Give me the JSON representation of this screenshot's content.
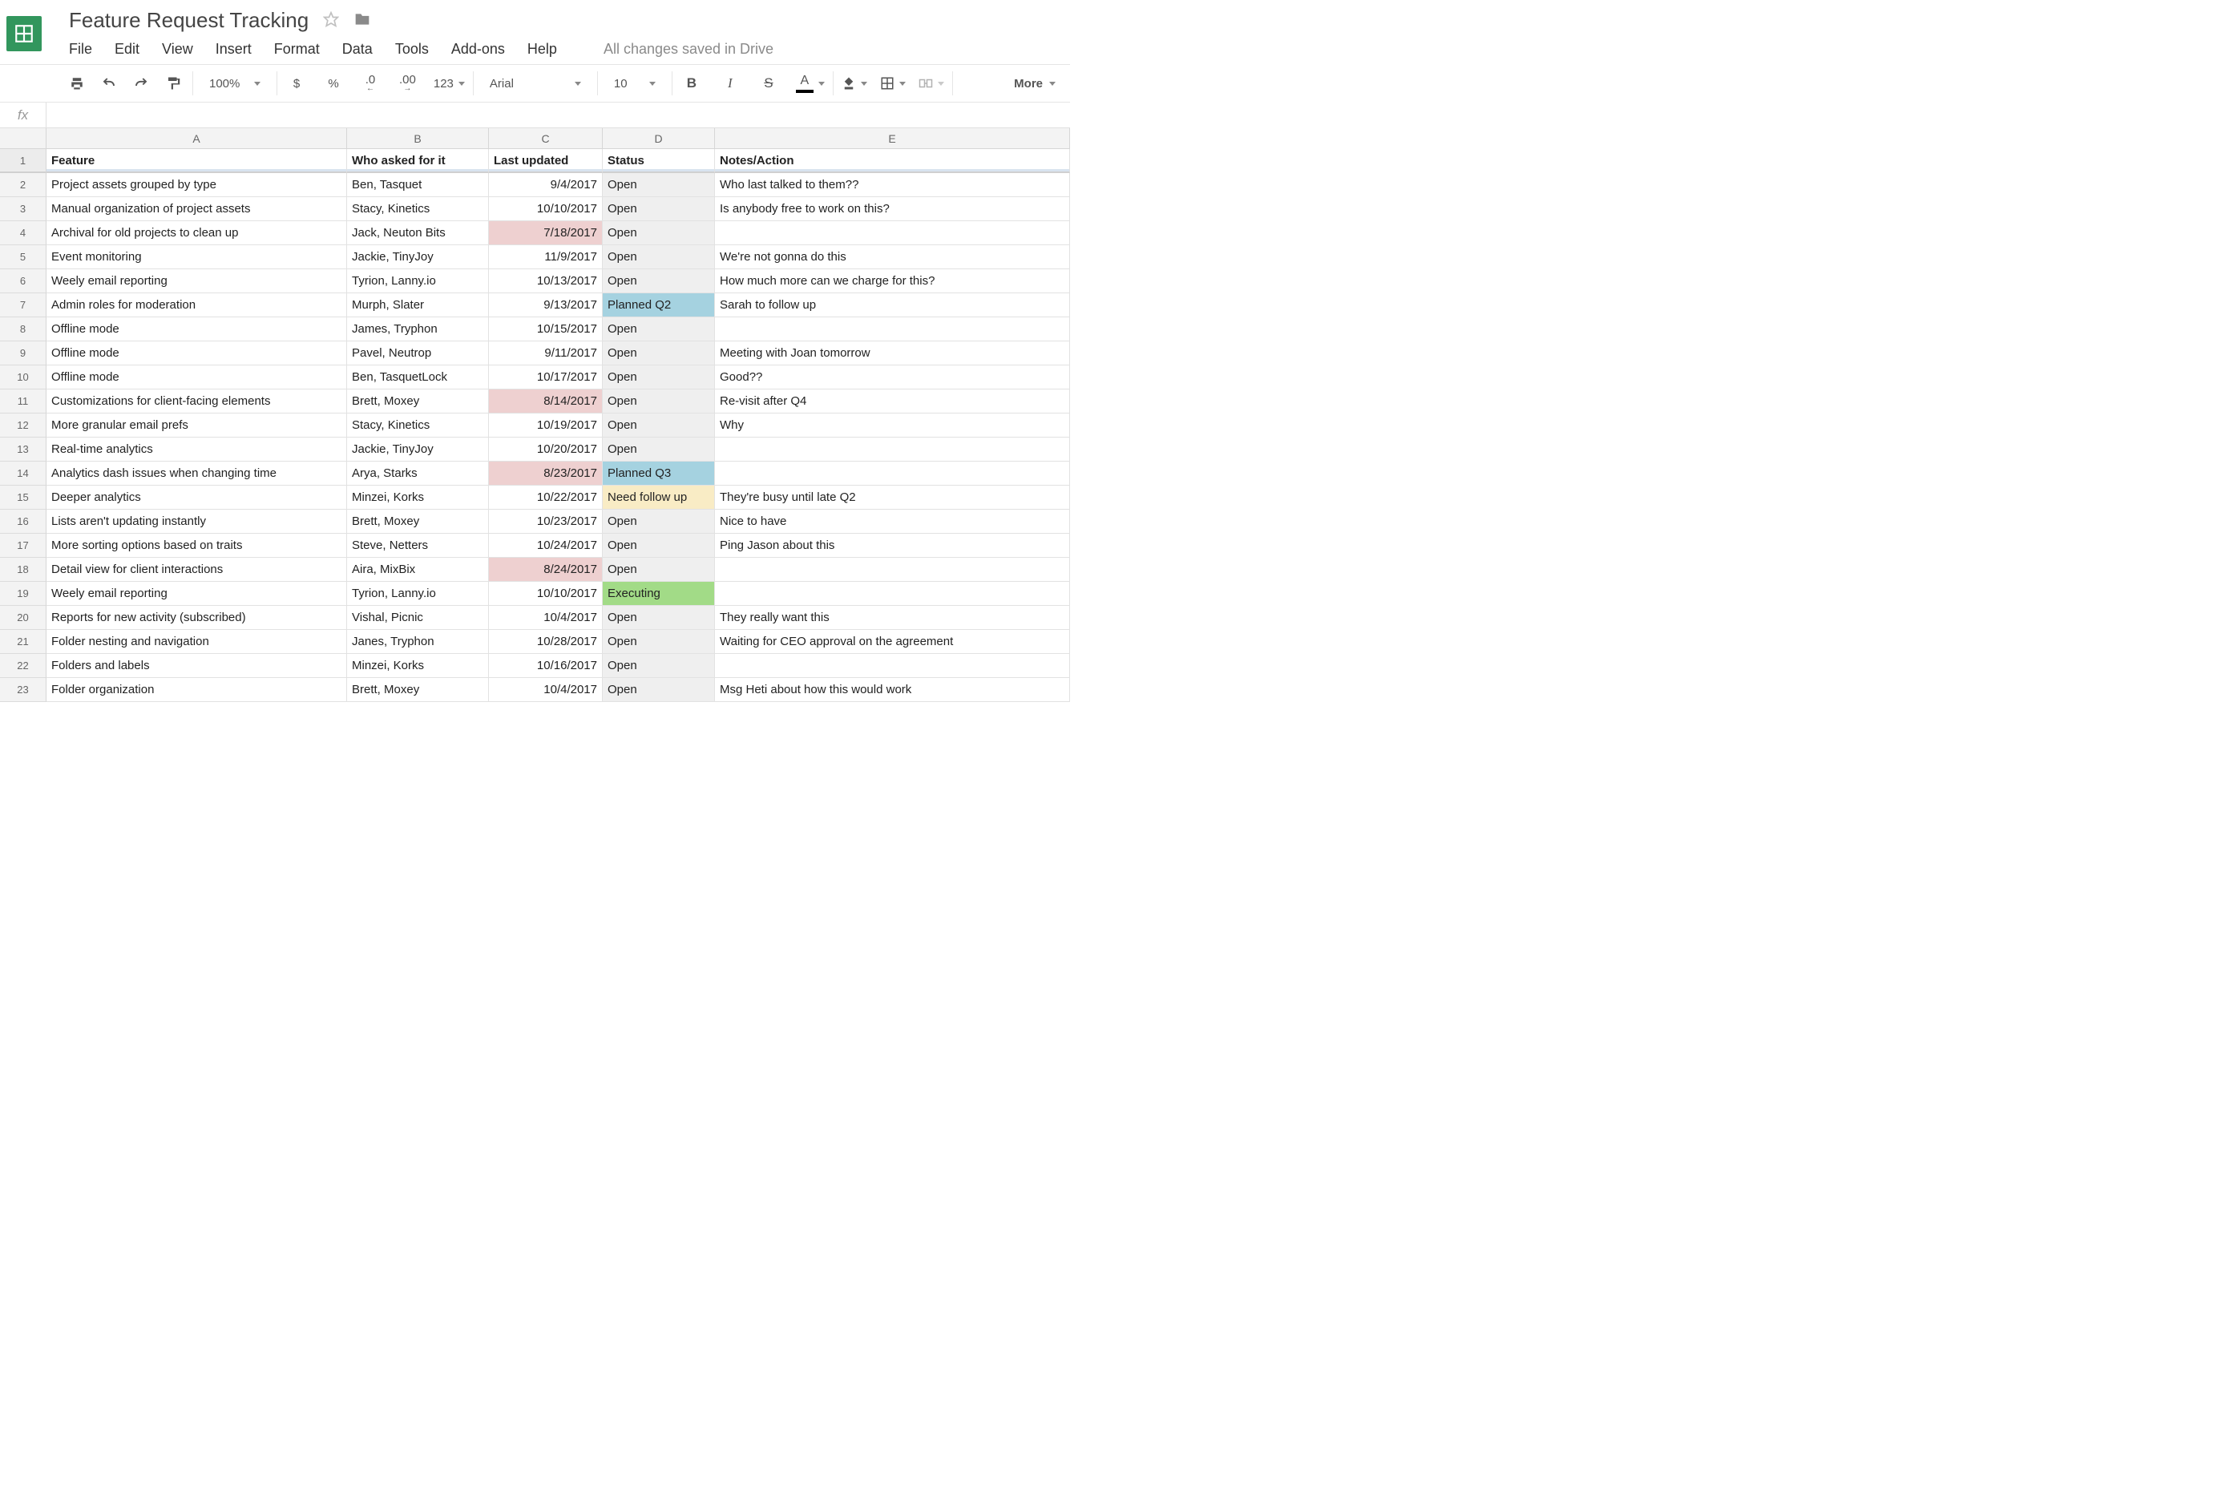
{
  "doc": {
    "title": "Feature Request Tracking"
  },
  "menu": {
    "file": "File",
    "edit": "Edit",
    "view": "View",
    "insert": "Insert",
    "format": "Format",
    "data": "Data",
    "tools": "Tools",
    "addons": "Add-ons",
    "help": "Help",
    "save_status": "All changes saved in Drive"
  },
  "toolbar": {
    "zoom": "100%",
    "font": "Arial",
    "size": "10",
    "dollar": "$",
    "percent": "%",
    "dec_dec": ".0",
    "dec_inc": ".00",
    "num123": "123",
    "bold": "B",
    "italic": "I",
    "strike": "S",
    "textA": "A",
    "more": "More"
  },
  "formula": {
    "fx": "fx",
    "value": ""
  },
  "columns": [
    "A",
    "B",
    "C",
    "D",
    "E"
  ],
  "headers": {
    "feature": "Feature",
    "who": "Who asked for it",
    "updated": "Last updated",
    "status": "Status",
    "notes": "Notes/Action"
  },
  "rows": [
    {
      "n": "2",
      "a": "Project assets grouped by type",
      "b": "Ben, Tasquet",
      "c": "9/4/2017",
      "d": "Open",
      "dClass": "status-open",
      "e": "Who last talked to them??"
    },
    {
      "n": "3",
      "a": "Manual organization of project assets",
      "b": "Stacy, Kinetics",
      "c": "10/10/2017",
      "d": "Open",
      "dClass": "status-open",
      "e": "Is anybody free to work on this?"
    },
    {
      "n": "4",
      "a": "Archival for old projects to clean up",
      "b": "Jack, Neuton Bits",
      "c": "7/18/2017",
      "cClass": "date-red",
      "d": "Open",
      "dClass": "status-open",
      "e": ""
    },
    {
      "n": "5",
      "a": "Event monitoring",
      "b": "Jackie, TinyJoy",
      "c": "11/9/2017",
      "d": "Open",
      "dClass": "status-open",
      "e": "We're not gonna do this"
    },
    {
      "n": "6",
      "a": "Weely email reporting",
      "b": "Tyrion, Lanny.io",
      "c": "10/13/2017",
      "d": "Open",
      "dClass": "status-open",
      "e": "How much more can we charge for this?"
    },
    {
      "n": "7",
      "a": "Admin roles for moderation",
      "b": "Murph, Slater",
      "c": "9/13/2017",
      "d": "Planned Q2",
      "dClass": "status-planned",
      "e": "Sarah to follow up"
    },
    {
      "n": "8",
      "a": "Offline mode",
      "b": "James, Tryphon",
      "c": "10/15/2017",
      "d": "Open",
      "dClass": "status-open",
      "e": ""
    },
    {
      "n": "9",
      "a": "Offline mode",
      "b": "Pavel, Neutrop",
      "c": "9/11/2017",
      "d": "Open",
      "dClass": "status-open",
      "e": "Meeting with Joan tomorrow"
    },
    {
      "n": "10",
      "a": "Offline mode",
      "b": "Ben, TasquetLock",
      "c": "10/17/2017",
      "d": "Open",
      "dClass": "status-open",
      "e": "Good??"
    },
    {
      "n": "11",
      "a": "Customizations for client-facing elements",
      "b": "Brett, Moxey",
      "c": "8/14/2017",
      "cClass": "date-red",
      "d": "Open",
      "dClass": "status-open",
      "e": "Re-visit after Q4"
    },
    {
      "n": "12",
      "a": "More granular email prefs",
      "b": "Stacy, Kinetics",
      "c": "10/19/2017",
      "d": "Open",
      "dClass": "status-open",
      "e": "Why"
    },
    {
      "n": "13",
      "a": "Real-time analytics",
      "b": "Jackie, TinyJoy",
      "c": "10/20/2017",
      "d": "Open",
      "dClass": "status-open",
      "e": ""
    },
    {
      "n": "14",
      "a": "Analytics dash issues when changing time",
      "b": "Arya, Starks",
      "c": "8/23/2017",
      "cClass": "date-red",
      "d": "Planned Q3",
      "dClass": "status-planned",
      "e": ""
    },
    {
      "n": "15",
      "a": "Deeper analytics",
      "b": "Minzei, Korks",
      "c": "10/22/2017",
      "d": "Need follow up",
      "dClass": "status-followup",
      "e": "They're busy until late Q2"
    },
    {
      "n": "16",
      "a": "Lists aren't updating instantly",
      "b": "Brett, Moxey",
      "c": "10/23/2017",
      "d": "Open",
      "dClass": "status-open",
      "e": "Nice to have"
    },
    {
      "n": "17",
      "a": "More sorting options based on traits",
      "b": "Steve, Netters",
      "c": "10/24/2017",
      "d": "Open",
      "dClass": "status-open",
      "e": "Ping Jason about this"
    },
    {
      "n": "18",
      "a": "Detail view for client interactions",
      "b": "Aira, MixBix",
      "c": "8/24/2017",
      "cClass": "date-red",
      "d": "Open",
      "dClass": "status-open",
      "e": ""
    },
    {
      "n": "19",
      "a": "Weely email reporting",
      "b": "Tyrion, Lanny.io",
      "c": "10/10/2017",
      "d": "Executing",
      "dClass": "status-exec",
      "e": ""
    },
    {
      "n": "20",
      "a": "Reports for new activity (subscribed)",
      "b": "Vishal, Picnic",
      "c": "10/4/2017",
      "d": "Open",
      "dClass": "status-open",
      "e": "They really want this"
    },
    {
      "n": "21",
      "a": "Folder nesting and navigation",
      "b": "Janes, Tryphon",
      "c": "10/28/2017",
      "d": "Open",
      "dClass": "status-open",
      "e": "Waiting for CEO approval on the agreement"
    },
    {
      "n": "22",
      "a": "Folders and labels",
      "b": "Minzei, Korks",
      "c": "10/16/2017",
      "d": "Open",
      "dClass": "status-open",
      "e": ""
    },
    {
      "n": "23",
      "a": "Folder organization",
      "b": "Brett, Moxey",
      "c": "10/4/2017",
      "d": "Open",
      "dClass": "status-open",
      "e": "Msg Heti about how this would work"
    }
  ]
}
